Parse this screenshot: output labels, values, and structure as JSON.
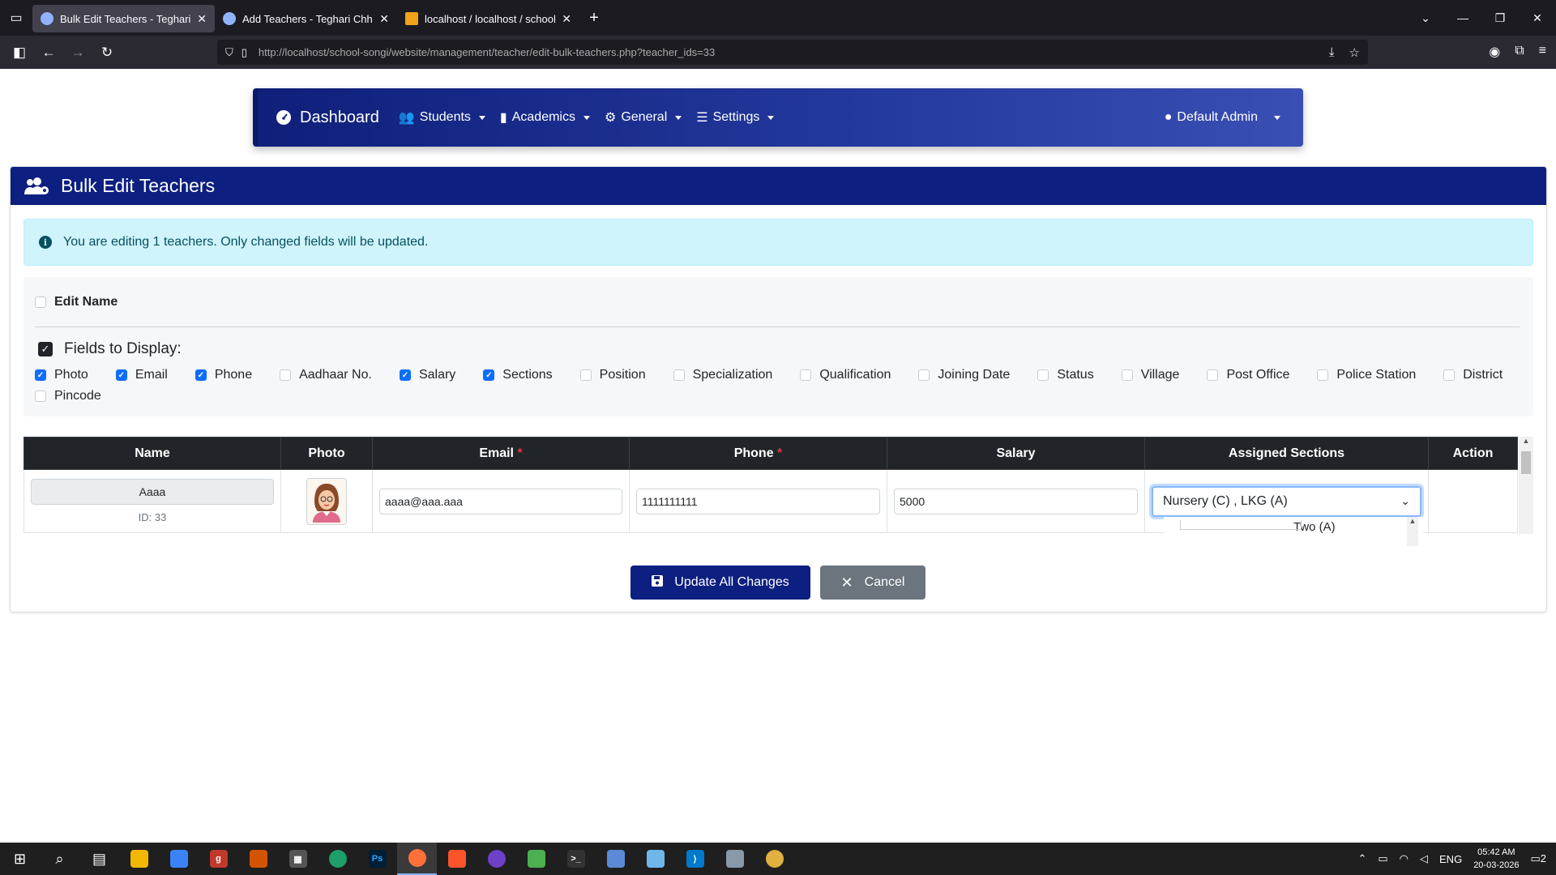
{
  "browser": {
    "tabs": [
      {
        "title": "Bulk Edit Teachers - Teghari Chh",
        "active": true
      },
      {
        "title": "Add Teachers - Teghari Chhaya",
        "active": false
      },
      {
        "title": "localhost / localhost / school_sy",
        "active": false
      }
    ],
    "url": "http://localhost/school-songi/website/management/teacher/edit-bulk-teachers.php?teacher_ids=33"
  },
  "nav": {
    "brand": "Dashboard",
    "items": [
      "Students",
      "Academics",
      "General",
      "Settings"
    ],
    "user": "Default Admin"
  },
  "page": {
    "title": "Bulk Edit Teachers",
    "alert": "You are editing 1 teachers. Only changed fields will be updated.",
    "edit_name_label": "Edit Name",
    "fields_title": "Fields to Display:",
    "fields": [
      {
        "label": "Photo",
        "checked": true
      },
      {
        "label": "Email",
        "checked": true
      },
      {
        "label": "Phone",
        "checked": true
      },
      {
        "label": "Aadhaar No.",
        "checked": false
      },
      {
        "label": "Salary",
        "checked": true
      },
      {
        "label": "Sections",
        "checked": true
      },
      {
        "label": "Position",
        "checked": false
      },
      {
        "label": "Specialization",
        "checked": false
      },
      {
        "label": "Qualification",
        "checked": false
      },
      {
        "label": "Joining Date",
        "checked": false
      },
      {
        "label": "Status",
        "checked": false
      },
      {
        "label": "Village",
        "checked": false
      },
      {
        "label": "Post Office",
        "checked": false
      },
      {
        "label": "Police Station",
        "checked": false
      },
      {
        "label": "District",
        "checked": false
      },
      {
        "label": "Pincode",
        "checked": false
      }
    ]
  },
  "table": {
    "headers": {
      "name": "Name",
      "photo": "Photo",
      "email": "Email",
      "phone": "Phone",
      "salary": "Salary",
      "sections": "Assigned Sections",
      "action": "Action"
    },
    "required_mark": "*",
    "row": {
      "name": "Aaaa",
      "id": "ID: 33",
      "email": "aaaa@aaa.aaa",
      "phone": "1111111111",
      "salary": "5000",
      "sections": "Nursery (C) , LKG (A)"
    },
    "dropdown_option": "Two (A)"
  },
  "buttons": {
    "update": "Update All Changes",
    "cancel": "Cancel"
  },
  "taskbar": {
    "lang": "ENG",
    "time": "05:42 AM",
    "date": "20-03-2026",
    "notifications": "2"
  },
  "colors": {
    "primary": "#0d1f80",
    "header_dark": "#212529",
    "alert_bg": "#cff4fc",
    "checkbox_blue": "#0d6efd"
  }
}
